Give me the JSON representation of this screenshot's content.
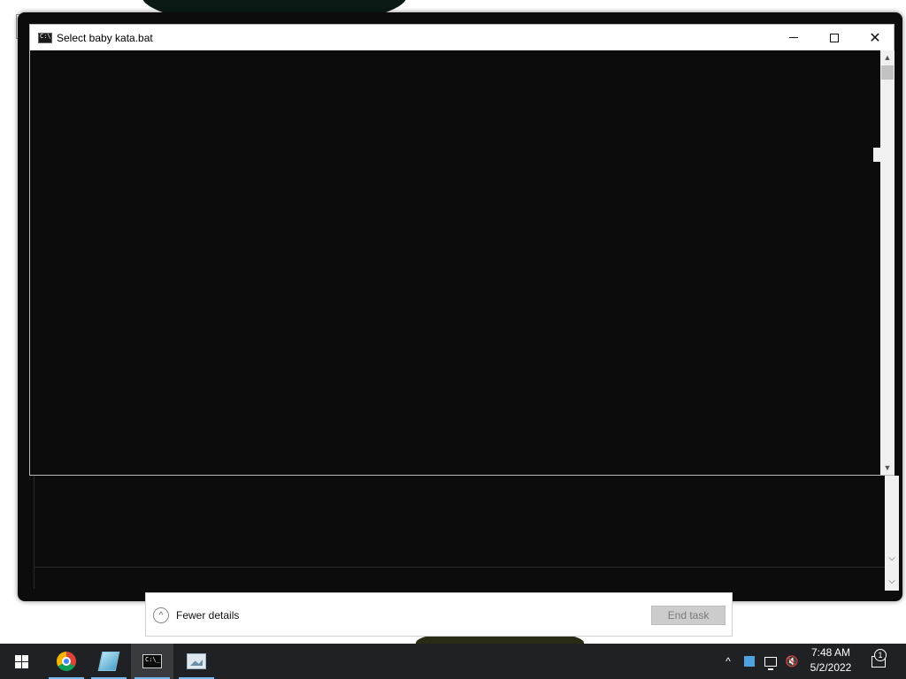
{
  "console": {
    "title": "Select baby kata.bat",
    "icon": "cmd-icon"
  },
  "window_controls": {
    "minimize": "minimize-icon",
    "maximize": "maximize-icon",
    "close": "close-icon",
    "close_glyph": "✕"
  },
  "task_manager": {
    "fewer_details_label": "Fewer details",
    "end_task_label": "End task"
  },
  "taskbar": {
    "apps": [
      "start-icon",
      "chrome-icon",
      "notes-icon",
      "cmd-icon",
      "photos-icon"
    ],
    "active_app": "cmd-icon"
  },
  "tray": {
    "chevron": "^",
    "volume": "🔇",
    "time": "7:48 AM",
    "date": "5/2/2022",
    "notification_count": "1"
  },
  "colors": {
    "console_bg": "#0c0c0c",
    "taskbar_bg": "#202124",
    "accent": "#76b9ed"
  }
}
